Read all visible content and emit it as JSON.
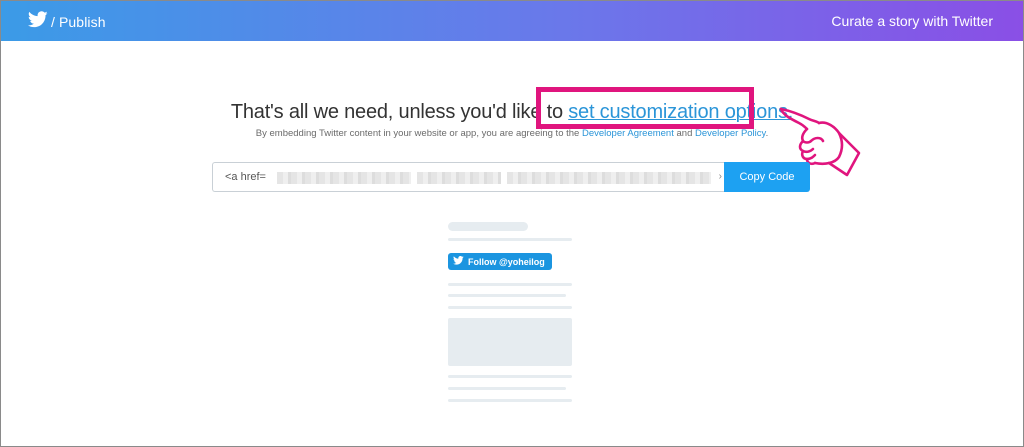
{
  "header": {
    "brand_label": "/ Publish",
    "right_link": "Curate a story with Twitter"
  },
  "main": {
    "headline_prefix": "That's all we need, unless you'd like to ",
    "headline_link": "set customization options.",
    "subline_prefix": "By embedding Twitter content in your website or app, you are agreeing to the ",
    "subline_link1": "Developer Agreement",
    "subline_mid": " and ",
    "subline_link2": "Developer Policy",
    "subline_end": "."
  },
  "embed": {
    "code_value": "<a href=",
    "code_end": "›",
    "copy_label": "Copy Code"
  },
  "preview": {
    "follow_label": "Follow @yoheilog"
  },
  "colors": {
    "header_gradient_start": "#3b9be7",
    "header_gradient_end": "#8a4fe6",
    "twitter_blue": "#1da1f2",
    "highlight": "#e0157e"
  }
}
